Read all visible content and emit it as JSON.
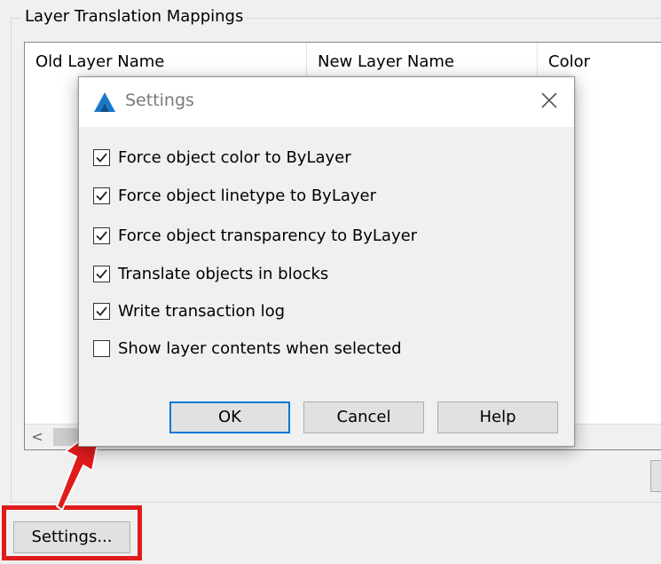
{
  "group": {
    "title": "Layer Translation Mappings"
  },
  "list": {
    "columns": [
      "Old Layer Name",
      "New Layer Name",
      "Color"
    ],
    "scroll_left_glyph": "<"
  },
  "main": {
    "settings_label": "Settings..."
  },
  "dialog": {
    "title": "Settings",
    "app_icon": "autocad-logo-icon",
    "close_icon": "close-icon",
    "options": [
      {
        "label": "Force object color to ByLayer",
        "checked": true
      },
      {
        "label": "Force object linetype to ByLayer",
        "checked": true
      },
      {
        "label": "Force object transparency to ByLayer",
        "checked": true
      },
      {
        "label": "Translate objects in blocks",
        "checked": true
      },
      {
        "label": "Write transaction log",
        "checked": true
      },
      {
        "label": "Show layer contents when selected",
        "checked": false
      }
    ],
    "buttons": {
      "ok": "OK",
      "cancel": "Cancel",
      "help": "Help"
    }
  },
  "colors": {
    "accent": "#0078d7",
    "highlight": "#e01b1b"
  }
}
